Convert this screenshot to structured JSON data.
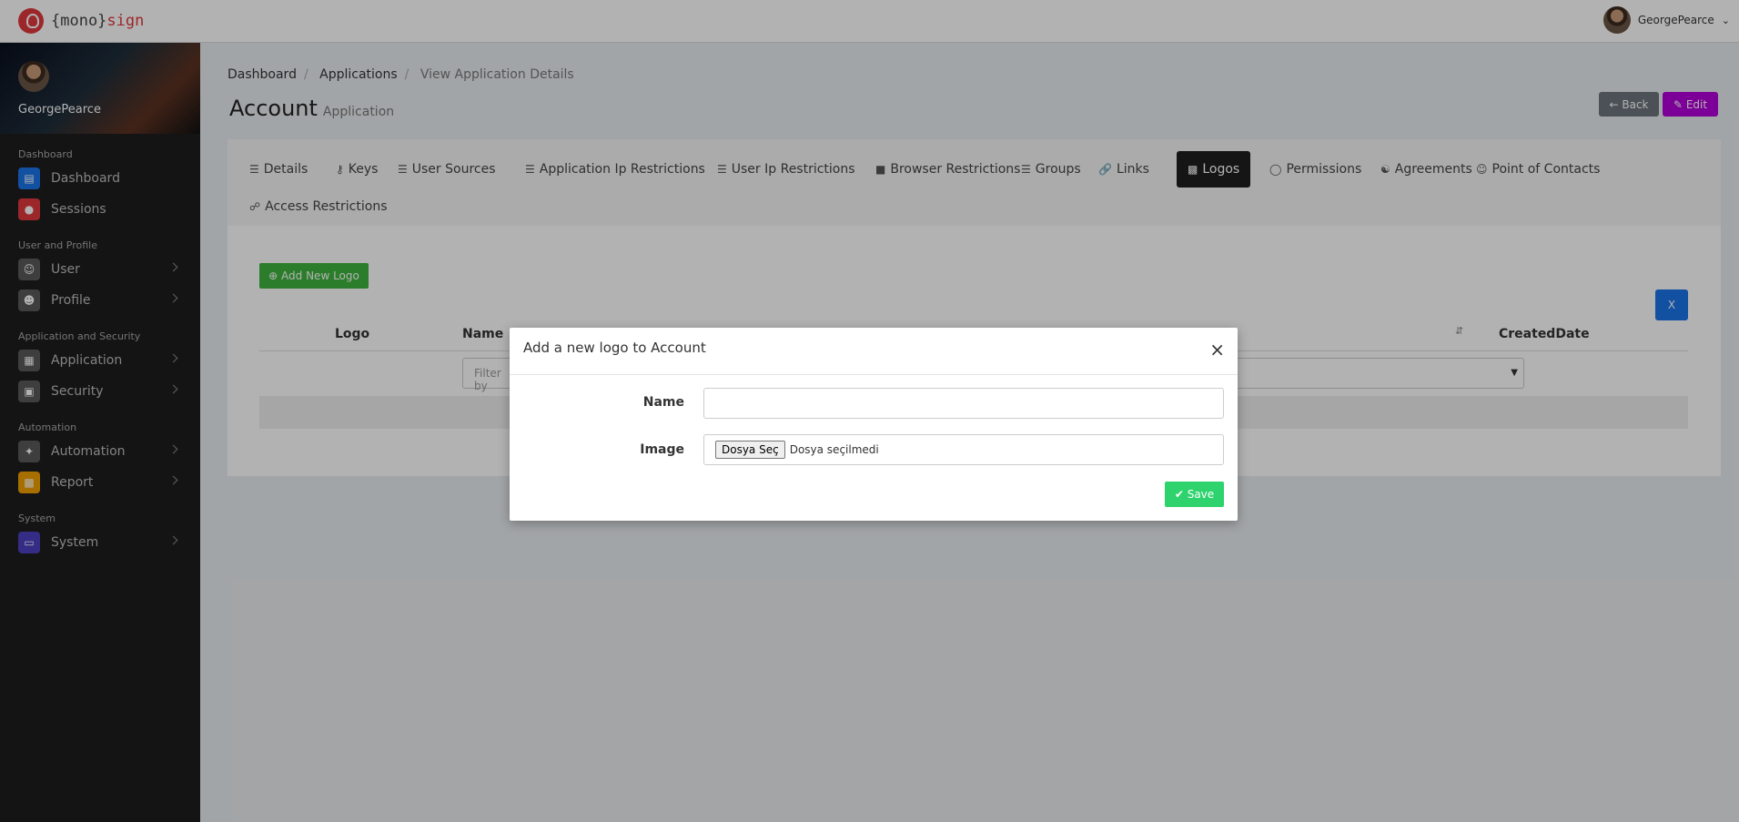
{
  "app": {
    "logo_left": "{mono}",
    "logo_right": "sign",
    "user": "GeorgePearce"
  },
  "sidebar": {
    "user": "GeorgePearce",
    "sections": [
      {
        "label": "Dashboard"
      },
      {
        "label": "User and Profile"
      },
      {
        "label": "Application and Security"
      },
      {
        "label": "Automation"
      },
      {
        "label": "System"
      }
    ],
    "items": [
      {
        "label": "Dashboard",
        "icon": "chart-icon",
        "color": "#1a73e8"
      },
      {
        "label": "Sessions",
        "icon": "record-icon",
        "color": "#e0383e"
      },
      {
        "label": "User",
        "icon": "users-icon",
        "color": "#5a5a5a"
      },
      {
        "label": "Profile",
        "icon": "user-icon",
        "color": "#5a5a5a"
      },
      {
        "label": "Application",
        "icon": "app-icon",
        "color": "#5a5a5a"
      },
      {
        "label": "Security",
        "icon": "lock-icon",
        "color": "#5a5a5a"
      },
      {
        "label": "Automation",
        "icon": "wand-icon",
        "color": "#5a5a5a"
      },
      {
        "label": "Report",
        "icon": "report-icon",
        "color": "#f0a000"
      },
      {
        "label": "System",
        "icon": "monitor-icon",
        "color": "#4b3fbf"
      }
    ]
  },
  "breadcrumb": {
    "items": [
      "Dashboard",
      "Applications",
      "View Application Details"
    ]
  },
  "page": {
    "title": "Account",
    "subtitle": "Application",
    "back": "Back",
    "edit": "Edit"
  },
  "tabs": [
    {
      "label": "Details",
      "icon": "list-icon"
    },
    {
      "label": "Keys",
      "icon": "key-icon"
    },
    {
      "label": "User Sources",
      "icon": "list-icon"
    },
    {
      "label": "Application Ip Restrictions",
      "icon": "list-icon"
    },
    {
      "label": "User Ip Restrictions",
      "icon": "list-icon"
    },
    {
      "label": "Browser Restrictions",
      "icon": "browser-icon"
    },
    {
      "label": "Groups",
      "icon": "list-icon"
    },
    {
      "label": "Links",
      "icon": "link-icon"
    },
    {
      "label": "Logos",
      "icon": "image-icon"
    },
    {
      "label": "Permissions",
      "icon": "toggle-icon"
    },
    {
      "label": "Agreements",
      "icon": "handshake-icon"
    },
    {
      "label": "Point of Contacts",
      "icon": "users-icon"
    },
    {
      "label": "Access Restrictions",
      "icon": "unlock-icon"
    }
  ],
  "content": {
    "add_button": "Add New Logo",
    "columns": [
      "Logo",
      "Name",
      "CreatedDate"
    ],
    "filter_placeholder": "Filter by"
  },
  "modal": {
    "title": "Add a new logo to Account",
    "name_label": "Name",
    "image_label": "Image",
    "file_button": "Dosya Seç",
    "file_status": "Dosya seçilmedi",
    "save": "Save"
  }
}
